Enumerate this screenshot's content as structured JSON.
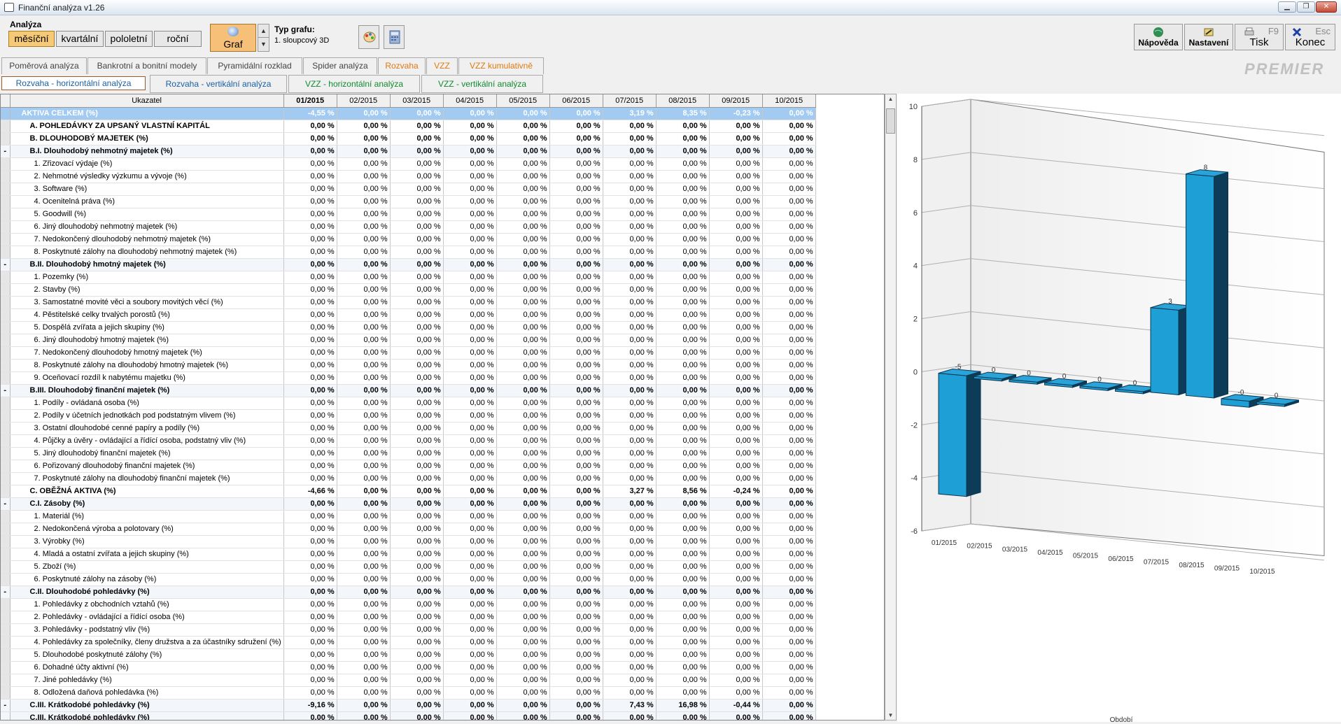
{
  "window": {
    "title": "Finanční analýza v1.26"
  },
  "toolbar": {
    "analyza_label": "Analýza",
    "periods": [
      {
        "label": "měsíční",
        "active": true
      },
      {
        "label": "kvartální",
        "active": false
      },
      {
        "label": "pololetní",
        "active": false
      },
      {
        "label": "roční",
        "active": false
      }
    ],
    "graf_label": "Graf",
    "typ_grafu_label": "Typ grafu:",
    "typ_grafu_value": "1. sloupcový 3D",
    "napoveda": "Nápověda",
    "nastaveni": "Nastavení",
    "tisk": "Tisk",
    "tisk_key": "F9",
    "konec": "Konec",
    "konec_key": "Esc",
    "logo": "PREMIER"
  },
  "tabs1": [
    {
      "label": "Poměrová analýza",
      "color": "normal"
    },
    {
      "label": "Bankrotní a bonitní modely",
      "color": "normal"
    },
    {
      "label": "Pyramidální rozklad",
      "color": "normal"
    },
    {
      "label": "Spider analýza",
      "color": "normal"
    },
    {
      "label": "Rozvaha",
      "color": "orange"
    },
    {
      "label": "VZZ",
      "color": "orange"
    },
    {
      "label": "VZZ kumulativně",
      "color": "orange"
    }
  ],
  "tabs2": [
    {
      "label": "Rozvaha - horizontální analýza",
      "color": "blue",
      "active": true
    },
    {
      "label": "Rozvaha - vertikální analýza",
      "color": "blue",
      "active": false
    },
    {
      "label": "VZZ - horizontální analýza",
      "color": "green",
      "active": false
    },
    {
      "label": "VZZ - vertikální analýza",
      "color": "green",
      "active": false
    }
  ],
  "table": {
    "header_indicator": "Ukazatel",
    "months": [
      "01/2015",
      "02/2015",
      "03/2015",
      "04/2015",
      "05/2015",
      "06/2015",
      "07/2015",
      "08/2015",
      "09/2015",
      "10/2015"
    ],
    "zero": "0,00 %",
    "rows": [
      {
        "g": "",
        "name": "AKTIVA CELKEM (%)",
        "lvl": "sel",
        "v": {
          "0": "-4,55 %",
          "6": "3,19 %",
          "7": "8,35 %",
          "8": "-0,23 %"
        }
      },
      {
        "g": "",
        "name": "A.     POHLEDÁVKY ZA UPSANÝ VLASTNÍ KAPITÁL",
        "lvl": "l0",
        "v": {}
      },
      {
        "g": "",
        "name": "B.     DLOUHODOBÝ MAJETEK (%)",
        "lvl": "l0",
        "v": {}
      },
      {
        "g": "-",
        "name": "B.I.   Dlouhodobý nehmotný majetek (%)",
        "lvl": "l1",
        "v": {}
      },
      {
        "g": "",
        "name": "1. Zřizovací výdaje (%)",
        "lvl": "l2",
        "v": {}
      },
      {
        "g": "",
        "name": "2. Nehmotné výsledky výzkumu a vývoje (%)",
        "lvl": "l2",
        "v": {}
      },
      {
        "g": "",
        "name": "3. Software (%)",
        "lvl": "l2",
        "v": {}
      },
      {
        "g": "",
        "name": "4. Ocenitelná práva (%)",
        "lvl": "l2",
        "v": {}
      },
      {
        "g": "",
        "name": "5. Goodwill (%)",
        "lvl": "l2",
        "v": {}
      },
      {
        "g": "",
        "name": "6. Jiný dlouhodobý nehmotný majetek (%)",
        "lvl": "l2",
        "v": {}
      },
      {
        "g": "",
        "name": "7. Nedokončený dlouhodobý nehmotný majetek (%)",
        "lvl": "l2",
        "v": {}
      },
      {
        "g": "",
        "name": "8. Poskytnuté zálohy na dlouhodobý nehmotný majetek (%)",
        "lvl": "l2",
        "v": {}
      },
      {
        "g": "-",
        "name": "B.II.  Dlouhodobý  hmotný majetek (%)",
        "lvl": "l1",
        "v": {}
      },
      {
        "g": "",
        "name": "1. Pozemky (%)",
        "lvl": "l2",
        "v": {}
      },
      {
        "g": "",
        "name": "2. Stavby (%)",
        "lvl": "l2",
        "v": {}
      },
      {
        "g": "",
        "name": "3. Samostatné movité věci a soubory movitých věcí (%)",
        "lvl": "l2",
        "v": {}
      },
      {
        "g": "",
        "name": "4. Pěstitelské celky trvalých porostů (%)",
        "lvl": "l2",
        "v": {}
      },
      {
        "g": "",
        "name": "5. Dospělá zvířata a jejich skupiny (%)",
        "lvl": "l2",
        "v": {}
      },
      {
        "g": "",
        "name": "6. Jiný dlouhodobý hmotný majetek (%)",
        "lvl": "l2",
        "v": {}
      },
      {
        "g": "",
        "name": "7. Nedokončený dlouhodobý hmotný majetek (%)",
        "lvl": "l2",
        "v": {}
      },
      {
        "g": "",
        "name": "8. Poskytnuté zálohy na dlouhodobý hmotný majetek (%)",
        "lvl": "l2",
        "v": {}
      },
      {
        "g": "",
        "name": "9. Oceňovací rozdíl k nabytému majetku (%)",
        "lvl": "l2",
        "v": {}
      },
      {
        "g": "-",
        "name": "B.III. Dlouhodobý finanční majetek (%)",
        "lvl": "l1",
        "v": {}
      },
      {
        "g": "",
        "name": "1. Podíly - ovládaná osoba (%)",
        "lvl": "l2",
        "v": {}
      },
      {
        "g": "",
        "name": "2. Podíly v účetních jednotkách pod podstatným vlivem (%)",
        "lvl": "l2",
        "v": {}
      },
      {
        "g": "",
        "name": "3. Ostatní dlouhodobé cenné papíry a podíly (%)",
        "lvl": "l2",
        "v": {}
      },
      {
        "g": "",
        "name": "4. Půjčky a úvěry - ovládající a řídící osoba, podstatný vliv (%)",
        "lvl": "l2",
        "v": {}
      },
      {
        "g": "",
        "name": "5. Jiný dlouhodobý finanční majetek (%)",
        "lvl": "l2",
        "v": {}
      },
      {
        "g": "",
        "name": "6. Pořizovaný dlouhodobý finanční majetek (%)",
        "lvl": "l2",
        "v": {}
      },
      {
        "g": "",
        "name": "7. Poskytnuté zálohy na dlouhodobý finanční majetek (%)",
        "lvl": "l2",
        "v": {}
      },
      {
        "g": "",
        "name": "C.     OBĚŽNÁ AKTIVA (%)",
        "lvl": "l0",
        "v": {
          "0": "-4,66 %",
          "6": "3,27 %",
          "7": "8,56 %",
          "8": "-0,24 %"
        }
      },
      {
        "g": "-",
        "name": "C.I.   Zásoby (%)",
        "lvl": "l1",
        "v": {}
      },
      {
        "g": "",
        "name": "1. Materiál (%)",
        "lvl": "l2",
        "v": {}
      },
      {
        "g": "",
        "name": "2. Nedokončená výroba a polotovary (%)",
        "lvl": "l2",
        "v": {}
      },
      {
        "g": "",
        "name": "3. Výrobky (%)",
        "lvl": "l2",
        "v": {}
      },
      {
        "g": "",
        "name": "4. Mladá a ostatní zvířata a jejich skupiny (%)",
        "lvl": "l2",
        "v": {}
      },
      {
        "g": "",
        "name": "5. Zboží (%)",
        "lvl": "l2",
        "v": {}
      },
      {
        "g": "",
        "name": "6. Poskytnuté zálohy na zásoby (%)",
        "lvl": "l2",
        "v": {}
      },
      {
        "g": "-",
        "name": "C.II.  Dlouhodobé pohledávky (%)",
        "lvl": "l1",
        "v": {}
      },
      {
        "g": "",
        "name": "1. Pohledávky z obchodních vztahů (%)",
        "lvl": "l2",
        "v": {}
      },
      {
        "g": "",
        "name": "2. Pohledávky - ovládající a řídící osoba (%)",
        "lvl": "l2",
        "v": {}
      },
      {
        "g": "",
        "name": "3. Pohledávky - podstatný vliv (%)",
        "lvl": "l2",
        "v": {}
      },
      {
        "g": "",
        "name": "4. Pohledávky za společníky, členy družstva a za účastníky sdružení (%)",
        "lvl": "l2",
        "v": {}
      },
      {
        "g": "",
        "name": "5. Dlouhodobé poskytnuté zálohy (%)",
        "lvl": "l2",
        "v": {}
      },
      {
        "g": "",
        "name": "6. Dohadné účty aktivní (%)",
        "lvl": "l2",
        "v": {}
      },
      {
        "g": "",
        "name": "7. Jiné pohledávky (%)",
        "lvl": "l2",
        "v": {}
      },
      {
        "g": "",
        "name": "8. Odložená daňová pohledávka (%)",
        "lvl": "l2",
        "v": {}
      },
      {
        "g": "-",
        "name": "C.III. Krátkodobé pohledávky (%)",
        "lvl": "l1",
        "v": {
          "0": "-9,16 %",
          "6": "7,43 %",
          "7": "16,98 %",
          "8": "-0,44 %"
        }
      },
      {
        "g": "",
        "name": "C.III. Krátkodobé pohledávky (%)",
        "lvl": "l1",
        "v": {}
      }
    ]
  },
  "chart_data": {
    "type": "bar",
    "style": "3D column",
    "categories": [
      "01/2015",
      "02/2015",
      "03/2015",
      "04/2015",
      "05/2015",
      "06/2015",
      "07/2015",
      "08/2015",
      "09/2015",
      "10/2015"
    ],
    "values": [
      -4.55,
      0,
      0,
      0,
      0,
      0,
      3.19,
      8.35,
      -0.23,
      0
    ],
    "data_labels": [
      "-5",
      "0",
      "0",
      "0",
      "0",
      "0",
      "3",
      "8",
      "-0",
      "0"
    ],
    "ylabel": "AKTIVA CELKEM (%)",
    "xlabel": "Období",
    "ylim": [
      -6,
      10
    ],
    "yticks": [
      -6,
      -4,
      -2,
      0,
      2,
      4,
      6,
      8,
      10
    ],
    "bar_color": "#1e9fd6",
    "grid": true
  }
}
